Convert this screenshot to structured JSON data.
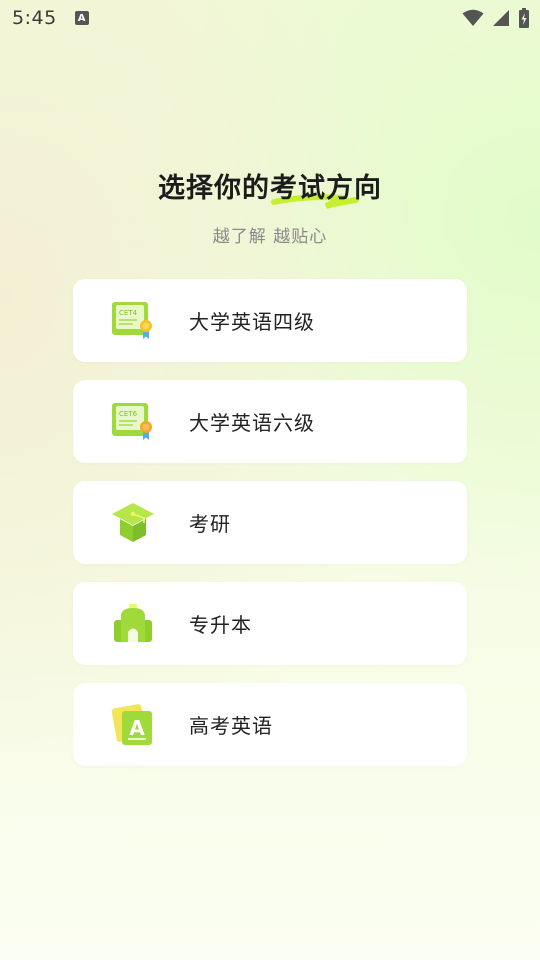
{
  "status_bar": {
    "time": "5:45",
    "notification_glyph": "A",
    "icons": [
      "wifi-icon",
      "signal-icon",
      "battery-charging-icon"
    ]
  },
  "header": {
    "title_part1": "选择你的",
    "title_part2": "考试方向",
    "subtitle": "越了解 越贴心"
  },
  "options": [
    {
      "label": "大学英语四级",
      "icon": "cet4-certificate-icon",
      "badge": "CET4"
    },
    {
      "label": "大学英语六级",
      "icon": "cet6-certificate-icon",
      "badge": "CET6"
    },
    {
      "label": "考研",
      "icon": "graduation-cap-icon"
    },
    {
      "label": "专升本",
      "icon": "school-building-icon"
    },
    {
      "label": "高考英语",
      "icon": "letter-a-cards-icon",
      "badge": "A"
    }
  ],
  "colors": {
    "accent_green": "#9fd93a",
    "dark_green": "#7cbf2a",
    "medal_orange": "#f5a623",
    "ribbon_blue": "#4fb0e8"
  }
}
